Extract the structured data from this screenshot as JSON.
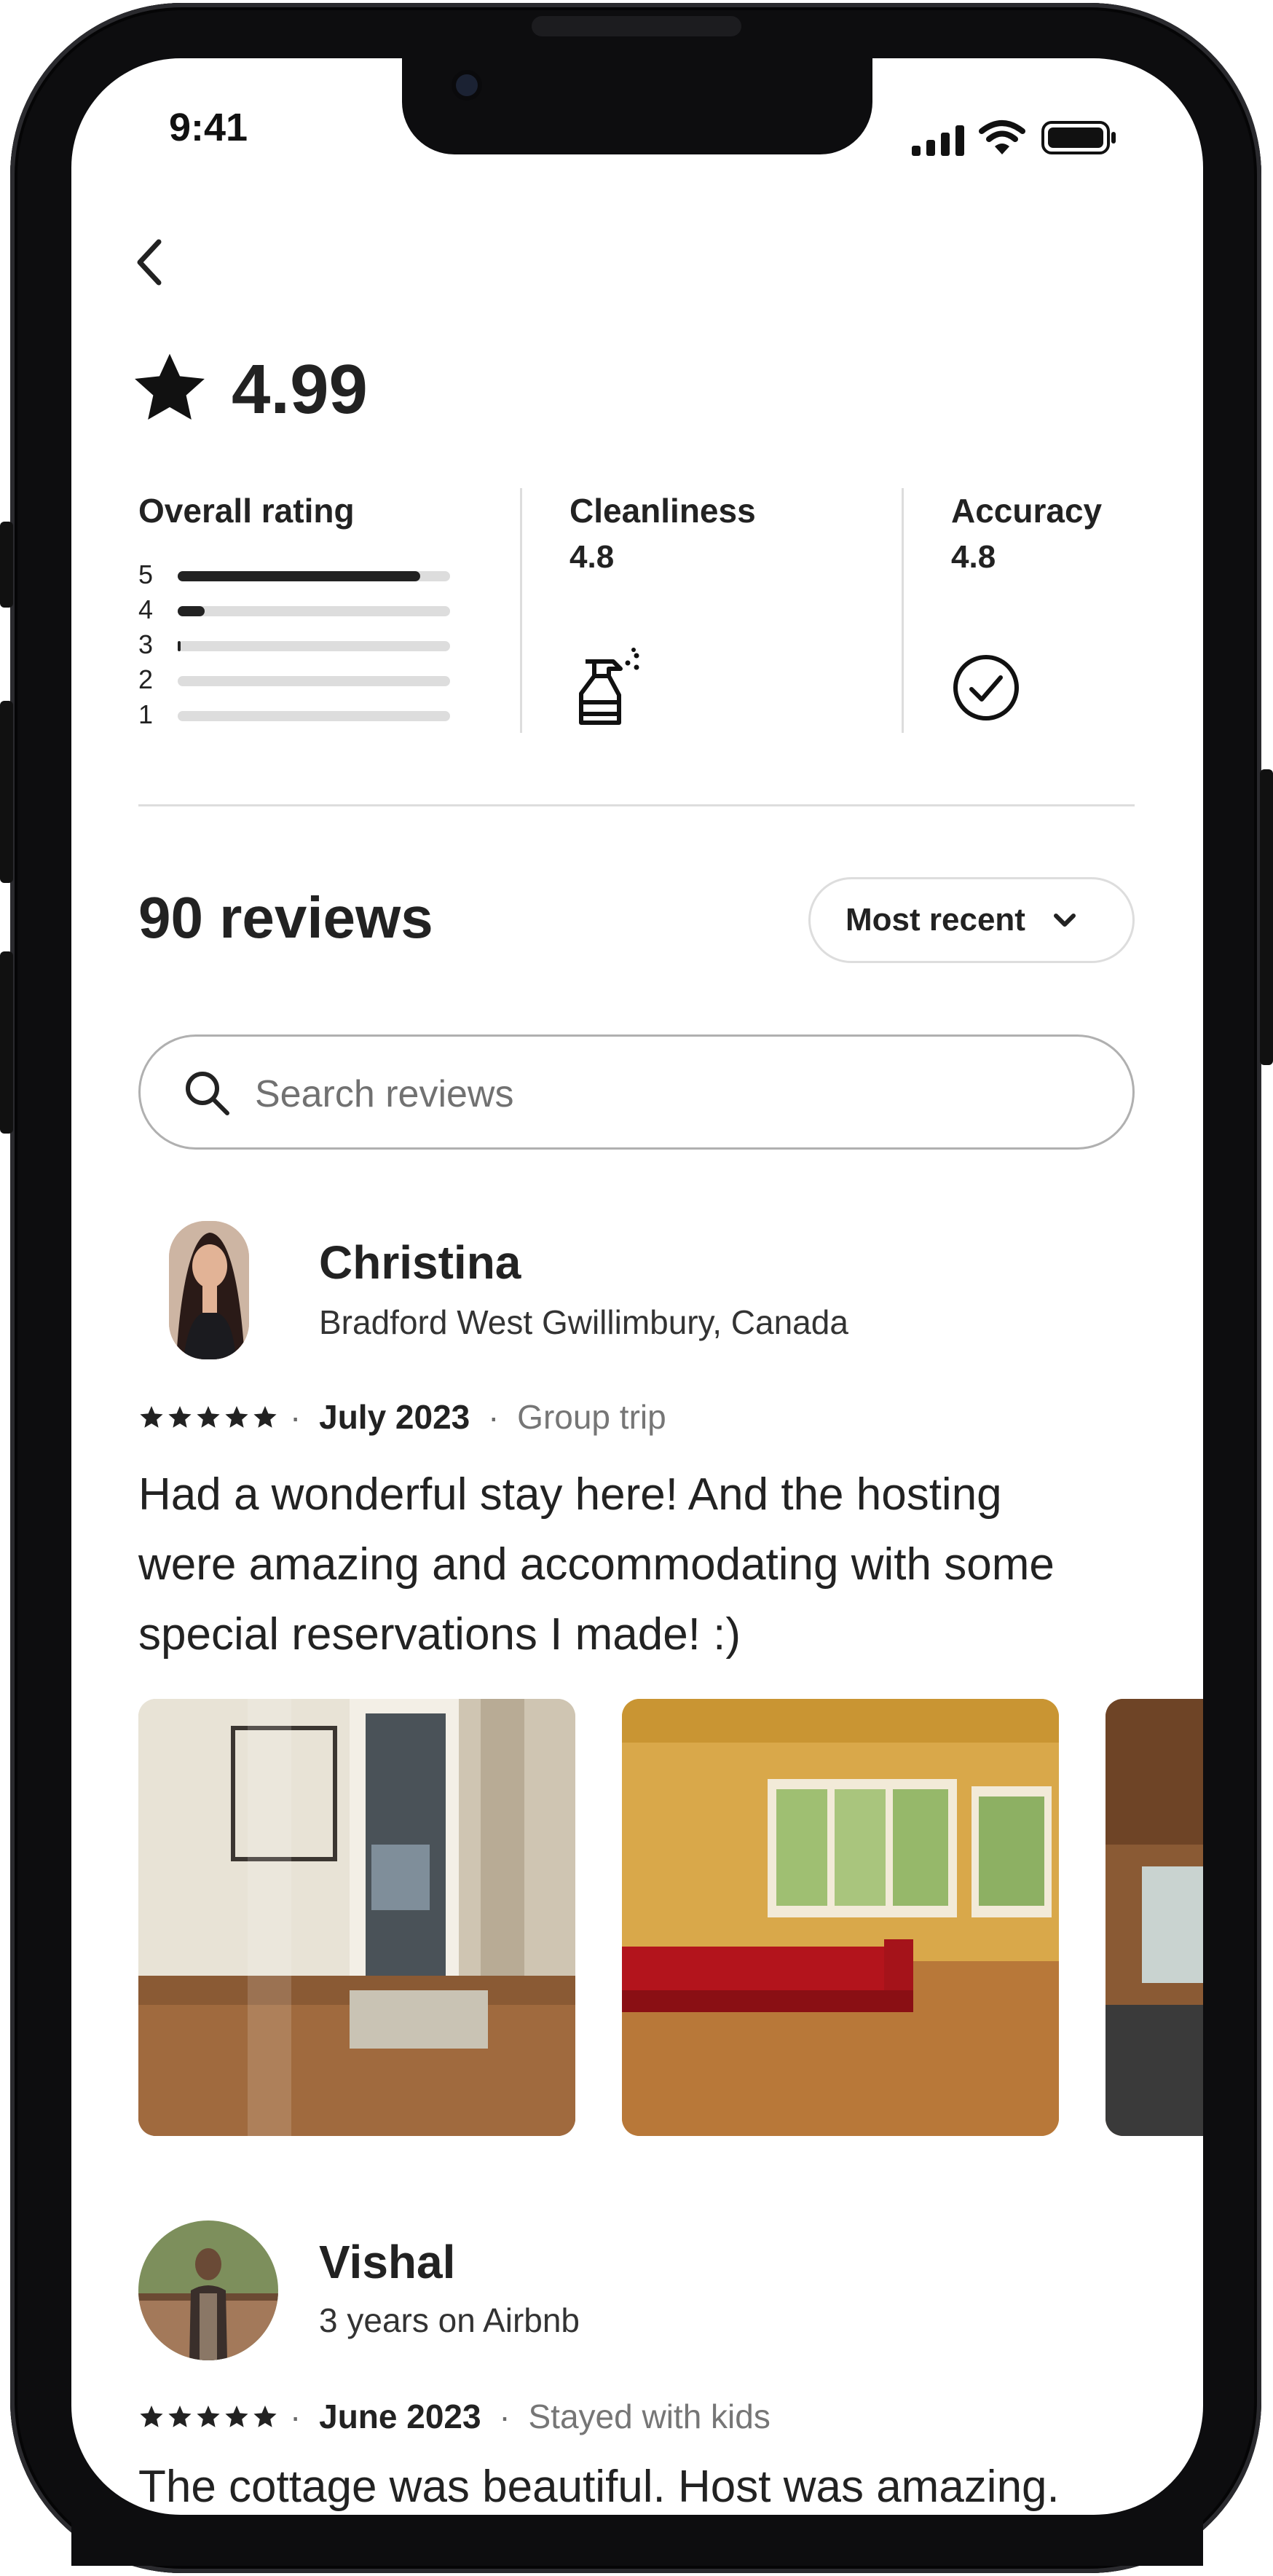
{
  "status_bar": {
    "time": "9:41"
  },
  "rating": {
    "score": "4.99"
  },
  "overall": {
    "label": "Overall rating",
    "rows": [
      {
        "star": "5",
        "fraction": 0.89
      },
      {
        "star": "4",
        "fraction": 0.1
      },
      {
        "star": "3",
        "fraction": 0.01
      },
      {
        "star": "2",
        "fraction": 0.0
      },
      {
        "star": "1",
        "fraction": 0.0
      }
    ]
  },
  "categories": [
    {
      "label": "Cleanliness",
      "value": "4.8",
      "icon": "spray-bottle-icon"
    },
    {
      "label": "Accuracy",
      "value": "4.8",
      "icon": "check-circle-icon"
    }
  ],
  "reviews_header": {
    "count_label": "90 reviews",
    "sort_label": "Most recent"
  },
  "search": {
    "placeholder": "Search reviews"
  },
  "reviews": [
    {
      "name": "Christina",
      "subtitle": "Bradford West Gwillimbury, Canada",
      "stars": 5,
      "date": "July 2023",
      "trip": "Group trip",
      "text_lines": [
        "Had a wonderful stay here! And the hosting",
        "were amazing and accommodating with some",
        "special reservations I made! :)"
      ]
    },
    {
      "name": "Vishal",
      "subtitle": "3 years on Airbnb",
      "stars": 5,
      "date": "June 2023",
      "trip": "Stayed with kids",
      "text_lines": [
        "The cottage was beautiful. Host was amazing."
      ]
    }
  ],
  "colors": {
    "text": "#222222",
    "muted": "#6a6a6a",
    "divider": "#dddddd",
    "frame": "#0d0d0f"
  }
}
